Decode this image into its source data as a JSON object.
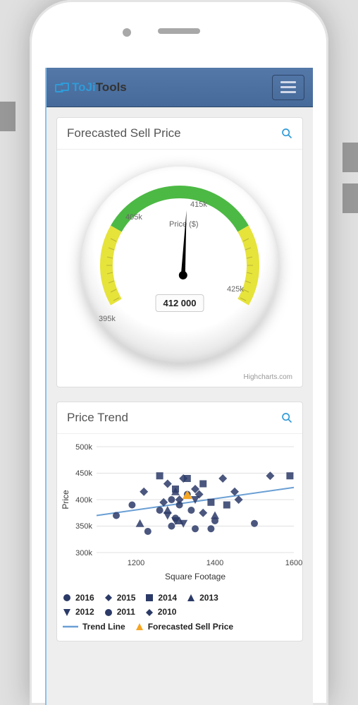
{
  "brand": {
    "prefix": "ToJi",
    "suffix": "Tools"
  },
  "panels": {
    "forecast": {
      "title": "Forecasted Sell Price",
      "credits": "Highcharts.com"
    },
    "trend": {
      "title": "Price Trend"
    }
  },
  "gauge": {
    "axis_label": "Price ($)",
    "value_display": "412 000",
    "ticks": {
      "t395": "395k",
      "t405": "405k",
      "t415": "415k",
      "t425": "425k"
    }
  },
  "chart_data": [
    {
      "type": "gauge",
      "title": "Forecasted Sell Price",
      "unit": "$",
      "min": 390000,
      "max": 430000,
      "value": 412000,
      "ticks": [
        395000,
        405000,
        415000,
        425000
      ],
      "bands": [
        {
          "from": 390000,
          "to": 402000,
          "color": "#e6e33b"
        },
        {
          "from": 402000,
          "to": 418000,
          "color": "#4cb944"
        },
        {
          "from": 418000,
          "to": 430000,
          "color": "#e6e33b"
        }
      ]
    },
    {
      "type": "scatter",
      "title": "Price Trend",
      "xlabel": "Square Footage",
      "ylabel": "Price",
      "xlim": [
        1100,
        1600
      ],
      "ylim": [
        300000,
        500000
      ],
      "xticks": [
        1200,
        1400,
        1600
      ],
      "yticks": [
        300000,
        350000,
        400000,
        450000,
        500000
      ],
      "yticklabels": [
        "300k",
        "350k",
        "400k",
        "450k",
        "500k"
      ],
      "series": [
        {
          "name": "2016",
          "marker": "circle",
          "color": "#2b3a67",
          "points": [
            [
              1150,
              370
            ],
            [
              1230,
              340
            ],
            [
              1290,
              350
            ],
            [
              1290,
              400
            ],
            [
              1300,
              365
            ],
            [
              1330,
              410
            ],
            [
              1350,
              345
            ],
            [
              1400,
              360
            ],
            [
              1500,
              355
            ]
          ]
        },
        {
          "name": "2015",
          "marker": "diamond",
          "color": "#2b3a67",
          "points": [
            [
              1220,
              415
            ],
            [
              1280,
              430
            ],
            [
              1310,
              400
            ],
            [
              1350,
              420
            ],
            [
              1370,
              375
            ],
            [
              1420,
              440
            ],
            [
              1450,
              415
            ],
            [
              1540,
              445
            ]
          ]
        },
        {
          "name": "2014",
          "marker": "square",
          "color": "#2b3a67",
          "points": [
            [
              1260,
              445
            ],
            [
              1300,
              420
            ],
            [
              1330,
              440
            ],
            [
              1370,
              430
            ],
            [
              1390,
              395
            ],
            [
              1430,
              390
            ],
            [
              1590,
              445
            ]
          ]
        },
        {
          "name": "2013",
          "marker": "triangle-up",
          "color": "#2b3a67",
          "points": [
            [
              1210,
              355
            ],
            [
              1280,
              380
            ],
            [
              1310,
              360
            ],
            [
              1400,
              370
            ],
            [
              1300,
              415
            ]
          ]
        },
        {
          "name": "2012",
          "marker": "triangle-down",
          "color": "#2b3a67",
          "points": [
            [
              1280,
              370
            ],
            [
              1300,
              360
            ],
            [
              1320,
              355
            ],
            [
              1350,
              400
            ]
          ]
        },
        {
          "name": "2011",
          "marker": "circle",
          "color": "#2b3a67",
          "points": [
            [
              1190,
              390
            ],
            [
              1260,
              380
            ],
            [
              1310,
              390
            ],
            [
              1340,
              380
            ],
            [
              1390,
              345
            ]
          ]
        },
        {
          "name": "2010",
          "marker": "diamond",
          "color": "#2b3a67",
          "points": [
            [
              1270,
              395
            ],
            [
              1320,
              440
            ],
            [
              1360,
              410
            ],
            [
              1460,
              400
            ]
          ]
        },
        {
          "name": "Trend Line",
          "type": "line",
          "color": "#6a9fd4",
          "points": [
            [
              1100,
              370
            ],
            [
              1600,
              423
            ]
          ]
        },
        {
          "name": "Forecasted Sell Price",
          "marker": "triangle-up",
          "color": "#f5a623",
          "points": [
            [
              1330,
              412
            ]
          ]
        }
      ]
    }
  ],
  "legend": {
    "y2016": "2016",
    "y2015": "2015",
    "y2014": "2014",
    "y2013": "2013",
    "y2012": "2012",
    "y2011": "2011",
    "y2010": "2010",
    "trend": "Trend Line",
    "forecast": "Forecasted Sell Price"
  },
  "scatter_labels": {
    "xlabel": "Square Footage",
    "ylabel": "Price",
    "y300": "300k",
    "y350": "350k",
    "y400": "400k",
    "y450": "450k",
    "y500": "500k",
    "x1200": "1200",
    "x1400": "1400",
    "x1600": "1600"
  }
}
